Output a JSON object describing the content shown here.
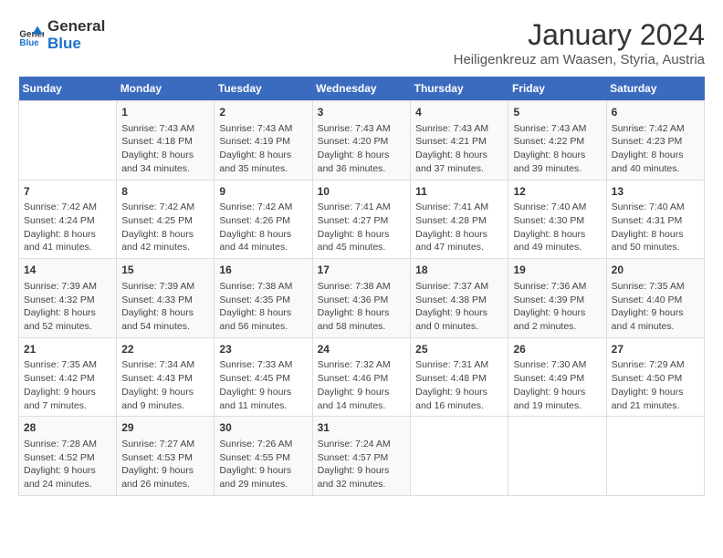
{
  "header": {
    "logo_general": "General",
    "logo_blue": "Blue",
    "month_title": "January 2024",
    "subtitle": "Heiligenkreuz am Waasen, Styria, Austria"
  },
  "calendar": {
    "days_of_week": [
      "Sunday",
      "Monday",
      "Tuesday",
      "Wednesday",
      "Thursday",
      "Friday",
      "Saturday"
    ],
    "weeks": [
      [
        {
          "day": "",
          "info": ""
        },
        {
          "day": "1",
          "info": "Sunrise: 7:43 AM\nSunset: 4:18 PM\nDaylight: 8 hours\nand 34 minutes."
        },
        {
          "day": "2",
          "info": "Sunrise: 7:43 AM\nSunset: 4:19 PM\nDaylight: 8 hours\nand 35 minutes."
        },
        {
          "day": "3",
          "info": "Sunrise: 7:43 AM\nSunset: 4:20 PM\nDaylight: 8 hours\nand 36 minutes."
        },
        {
          "day": "4",
          "info": "Sunrise: 7:43 AM\nSunset: 4:21 PM\nDaylight: 8 hours\nand 37 minutes."
        },
        {
          "day": "5",
          "info": "Sunrise: 7:43 AM\nSunset: 4:22 PM\nDaylight: 8 hours\nand 39 minutes."
        },
        {
          "day": "6",
          "info": "Sunrise: 7:42 AM\nSunset: 4:23 PM\nDaylight: 8 hours\nand 40 minutes."
        }
      ],
      [
        {
          "day": "7",
          "info": "Sunrise: 7:42 AM\nSunset: 4:24 PM\nDaylight: 8 hours\nand 41 minutes."
        },
        {
          "day": "8",
          "info": "Sunrise: 7:42 AM\nSunset: 4:25 PM\nDaylight: 8 hours\nand 42 minutes."
        },
        {
          "day": "9",
          "info": "Sunrise: 7:42 AM\nSunset: 4:26 PM\nDaylight: 8 hours\nand 44 minutes."
        },
        {
          "day": "10",
          "info": "Sunrise: 7:41 AM\nSunset: 4:27 PM\nDaylight: 8 hours\nand 45 minutes."
        },
        {
          "day": "11",
          "info": "Sunrise: 7:41 AM\nSunset: 4:28 PM\nDaylight: 8 hours\nand 47 minutes."
        },
        {
          "day": "12",
          "info": "Sunrise: 7:40 AM\nSunset: 4:30 PM\nDaylight: 8 hours\nand 49 minutes."
        },
        {
          "day": "13",
          "info": "Sunrise: 7:40 AM\nSunset: 4:31 PM\nDaylight: 8 hours\nand 50 minutes."
        }
      ],
      [
        {
          "day": "14",
          "info": "Sunrise: 7:39 AM\nSunset: 4:32 PM\nDaylight: 8 hours\nand 52 minutes."
        },
        {
          "day": "15",
          "info": "Sunrise: 7:39 AM\nSunset: 4:33 PM\nDaylight: 8 hours\nand 54 minutes."
        },
        {
          "day": "16",
          "info": "Sunrise: 7:38 AM\nSunset: 4:35 PM\nDaylight: 8 hours\nand 56 minutes."
        },
        {
          "day": "17",
          "info": "Sunrise: 7:38 AM\nSunset: 4:36 PM\nDaylight: 8 hours\nand 58 minutes."
        },
        {
          "day": "18",
          "info": "Sunrise: 7:37 AM\nSunset: 4:38 PM\nDaylight: 9 hours\nand 0 minutes."
        },
        {
          "day": "19",
          "info": "Sunrise: 7:36 AM\nSunset: 4:39 PM\nDaylight: 9 hours\nand 2 minutes."
        },
        {
          "day": "20",
          "info": "Sunrise: 7:35 AM\nSunset: 4:40 PM\nDaylight: 9 hours\nand 4 minutes."
        }
      ],
      [
        {
          "day": "21",
          "info": "Sunrise: 7:35 AM\nSunset: 4:42 PM\nDaylight: 9 hours\nand 7 minutes."
        },
        {
          "day": "22",
          "info": "Sunrise: 7:34 AM\nSunset: 4:43 PM\nDaylight: 9 hours\nand 9 minutes."
        },
        {
          "day": "23",
          "info": "Sunrise: 7:33 AM\nSunset: 4:45 PM\nDaylight: 9 hours\nand 11 minutes."
        },
        {
          "day": "24",
          "info": "Sunrise: 7:32 AM\nSunset: 4:46 PM\nDaylight: 9 hours\nand 14 minutes."
        },
        {
          "day": "25",
          "info": "Sunrise: 7:31 AM\nSunset: 4:48 PM\nDaylight: 9 hours\nand 16 minutes."
        },
        {
          "day": "26",
          "info": "Sunrise: 7:30 AM\nSunset: 4:49 PM\nDaylight: 9 hours\nand 19 minutes."
        },
        {
          "day": "27",
          "info": "Sunrise: 7:29 AM\nSunset: 4:50 PM\nDaylight: 9 hours\nand 21 minutes."
        }
      ],
      [
        {
          "day": "28",
          "info": "Sunrise: 7:28 AM\nSunset: 4:52 PM\nDaylight: 9 hours\nand 24 minutes."
        },
        {
          "day": "29",
          "info": "Sunrise: 7:27 AM\nSunset: 4:53 PM\nDaylight: 9 hours\nand 26 minutes."
        },
        {
          "day": "30",
          "info": "Sunrise: 7:26 AM\nSunset: 4:55 PM\nDaylight: 9 hours\nand 29 minutes."
        },
        {
          "day": "31",
          "info": "Sunrise: 7:24 AM\nSunset: 4:57 PM\nDaylight: 9 hours\nand 32 minutes."
        },
        {
          "day": "",
          "info": ""
        },
        {
          "day": "",
          "info": ""
        },
        {
          "day": "",
          "info": ""
        }
      ]
    ]
  }
}
